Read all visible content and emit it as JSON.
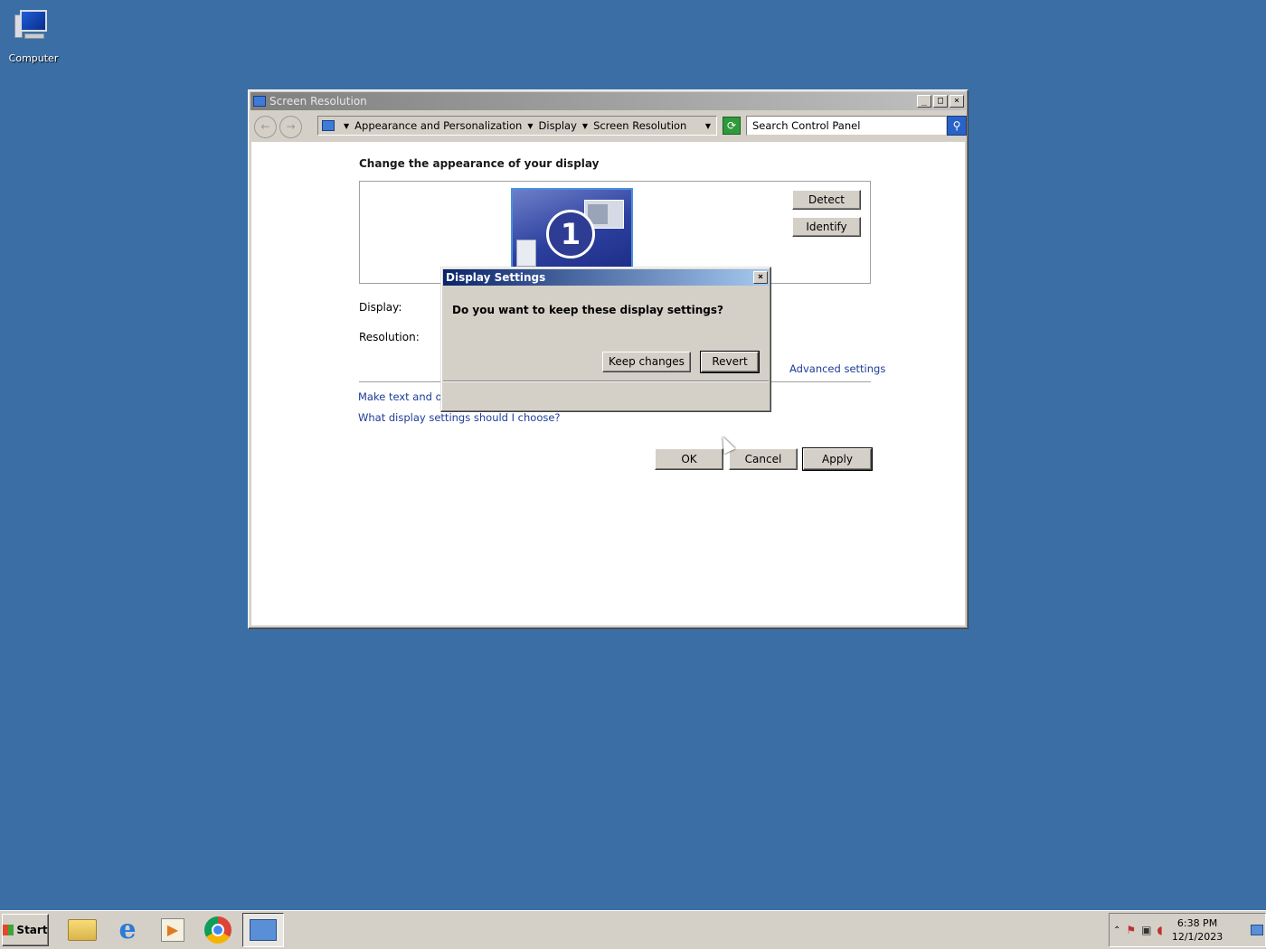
{
  "desktop": {
    "icons": [
      {
        "label": "Computer",
        "icon": "computer-icon"
      }
    ]
  },
  "window": {
    "title": "Screen Resolution",
    "controls": {
      "minimize": "_",
      "maximize": "□",
      "close": "×"
    },
    "address": {
      "crumbs": [
        "Appearance and Personalization",
        "Display",
        "Screen Resolution"
      ]
    },
    "search": {
      "placeholder": "Search Control Panel"
    },
    "content": {
      "heading": "Change the appearance of your display",
      "monitor_number": "1",
      "detect_label": "Detect",
      "identify_label": "Identify",
      "display_label": "Display:",
      "resolution_label": "Resolution:",
      "advanced_link": "Advanced settings",
      "link_text_size": "Make text and othe",
      "link_which_settings": "What display settings should I choose?",
      "ok_label": "OK",
      "cancel_label": "Cancel",
      "apply_label": "Apply"
    }
  },
  "dialog": {
    "title": "Display Settings",
    "close": "×",
    "message": "Do you want to keep these display settings?",
    "keep_label": "Keep changes",
    "revert_label": "Revert"
  },
  "taskbar": {
    "start_label": "Start",
    "apps": [
      "folder-icon",
      "internet-explorer-icon",
      "media-player-icon",
      "chrome-icon",
      "control-panel-icon"
    ],
    "clock": {
      "time": "6:38 PM",
      "date": "12/1/2023"
    }
  },
  "colors": {
    "desktop": "#3a6ea5",
    "chrome_face": "#d4d0c8",
    "dialog_title": "#0a246a",
    "link": "#1c3c9a"
  }
}
